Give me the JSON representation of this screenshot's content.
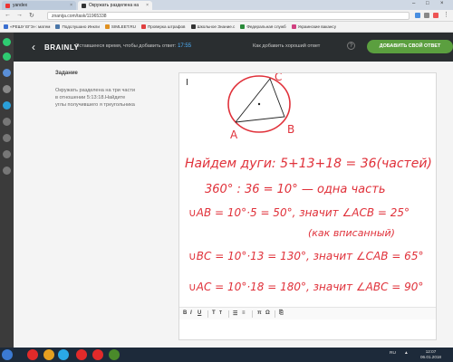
{
  "browser": {
    "tabs": [
      {
        "label": "yandex",
        "active": false
      },
      {
        "label": "Окружать разделена на",
        "active": true
      }
    ],
    "address": "znanija.com/task/11965338",
    "bookmarks": [
      "«РЕШУ ЕГЭ»: матем",
      "Подслушано Инкли",
      "SIMLEET.RU",
      "Проверка штрафов",
      "Школьное Знание.c",
      "Федеральная служб",
      "Украинские вакансу"
    ]
  },
  "header": {
    "logo": "BRAINLY",
    "remaining_label": "Оставшееся время, чтобы добавить ответ:",
    "remaining_time": "17:55",
    "howto_label": "Как добавить хороший ответ",
    "help_icon": "?",
    "add_button": "ДОБАВИТЬ СВОЙ ОТВЕТ"
  },
  "task": {
    "title": "Задание",
    "text": "Окружать разделена на три части в отношении 5:13:18.Найдите углы получившего я треугольника"
  },
  "answer": {
    "diagram_labels": {
      "a": "A",
      "b": "B",
      "c": "C"
    },
    "lines": [
      "Найдем дуги:   5+13+18 = 36(частей)",
      "360° : 36 = 10° — одна часть",
      "∪AB = 10°·5 = 50°, значит ∠ACB = 25°",
      "(как вписанный)",
      "∪BC = 10°·13 = 130°, значит ∠CAB = 65°",
      "∪AC = 10°·18 = 180°, значит ∠ABC = 90°"
    ]
  },
  "toolbar": {
    "bold": "B",
    "italic": "I",
    "underline": "U",
    "sub": "T",
    "sup": "T",
    "list": "☰",
    "numlist": "≡",
    "pi": "π",
    "omega": "Ω",
    "attach": "⎘"
  },
  "taskbar": {
    "lang": "RU",
    "time": "12:07",
    "date": "06.01.2018"
  },
  "colors": {
    "ink": "#e0313a",
    "brainly_dark": "#2a2e30",
    "accent_blue": "#4fb3ff",
    "button_green": "#5b9f3f"
  }
}
